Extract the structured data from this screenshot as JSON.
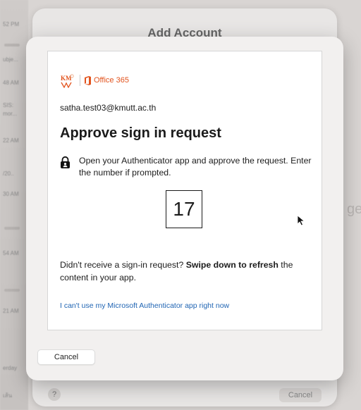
{
  "background": {
    "dialog_title": "Add Account",
    "help_label": "?",
    "cancel_label": "Cancel",
    "ghost_text": "ge",
    "timestamps": [
      "52 PM",
      "48 AM",
      "22 AM",
      "30 AM",
      "54 AM",
      "21 AM"
    ],
    "snippets": [
      "ubje...",
      "SIS:",
      "mor...",
      "/20..",
      "erday",
      "เส้น"
    ]
  },
  "sheet": {
    "logo": {
      "org_mark": "KM",
      "product_name": "Office 365",
      "brand_color": "#e2531d"
    },
    "email": "satha.test03@kmutt.ac.th",
    "title": "Approve sign in request",
    "instruction": "Open your Authenticator app and approve the request. Enter the number if prompted.",
    "number": "17",
    "refresh_prefix": "Didn't receive a sign-in request? ",
    "refresh_bold": "Swipe down to refresh",
    "refresh_suffix": " the content in your app.",
    "cant_use_link": "I can't use my Microsoft Authenticator app right now",
    "link_color": "#1f64b3",
    "cancel_label": "Cancel"
  }
}
